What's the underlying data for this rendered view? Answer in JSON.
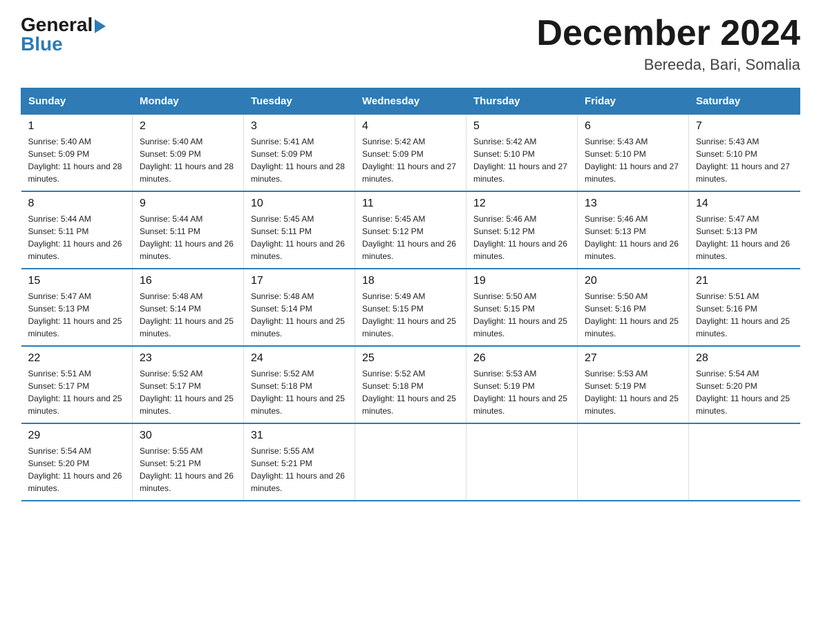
{
  "logo": {
    "general": "General",
    "blue": "Blue"
  },
  "header": {
    "month": "December 2024",
    "location": "Bereeda, Bari, Somalia"
  },
  "weekdays": [
    "Sunday",
    "Monday",
    "Tuesday",
    "Wednesday",
    "Thursday",
    "Friday",
    "Saturday"
  ],
  "weeks": [
    [
      {
        "day": "1",
        "sunrise": "5:40 AM",
        "sunset": "5:09 PM",
        "daylight": "11 hours and 28 minutes."
      },
      {
        "day": "2",
        "sunrise": "5:40 AM",
        "sunset": "5:09 PM",
        "daylight": "11 hours and 28 minutes."
      },
      {
        "day": "3",
        "sunrise": "5:41 AM",
        "sunset": "5:09 PM",
        "daylight": "11 hours and 28 minutes."
      },
      {
        "day": "4",
        "sunrise": "5:42 AM",
        "sunset": "5:09 PM",
        "daylight": "11 hours and 27 minutes."
      },
      {
        "day": "5",
        "sunrise": "5:42 AM",
        "sunset": "5:10 PM",
        "daylight": "11 hours and 27 minutes."
      },
      {
        "day": "6",
        "sunrise": "5:43 AM",
        "sunset": "5:10 PM",
        "daylight": "11 hours and 27 minutes."
      },
      {
        "day": "7",
        "sunrise": "5:43 AM",
        "sunset": "5:10 PM",
        "daylight": "11 hours and 27 minutes."
      }
    ],
    [
      {
        "day": "8",
        "sunrise": "5:44 AM",
        "sunset": "5:11 PM",
        "daylight": "11 hours and 26 minutes."
      },
      {
        "day": "9",
        "sunrise": "5:44 AM",
        "sunset": "5:11 PM",
        "daylight": "11 hours and 26 minutes."
      },
      {
        "day": "10",
        "sunrise": "5:45 AM",
        "sunset": "5:11 PM",
        "daylight": "11 hours and 26 minutes."
      },
      {
        "day": "11",
        "sunrise": "5:45 AM",
        "sunset": "5:12 PM",
        "daylight": "11 hours and 26 minutes."
      },
      {
        "day": "12",
        "sunrise": "5:46 AM",
        "sunset": "5:12 PM",
        "daylight": "11 hours and 26 minutes."
      },
      {
        "day": "13",
        "sunrise": "5:46 AM",
        "sunset": "5:13 PM",
        "daylight": "11 hours and 26 minutes."
      },
      {
        "day": "14",
        "sunrise": "5:47 AM",
        "sunset": "5:13 PM",
        "daylight": "11 hours and 26 minutes."
      }
    ],
    [
      {
        "day": "15",
        "sunrise": "5:47 AM",
        "sunset": "5:13 PM",
        "daylight": "11 hours and 25 minutes."
      },
      {
        "day": "16",
        "sunrise": "5:48 AM",
        "sunset": "5:14 PM",
        "daylight": "11 hours and 25 minutes."
      },
      {
        "day": "17",
        "sunrise": "5:48 AM",
        "sunset": "5:14 PM",
        "daylight": "11 hours and 25 minutes."
      },
      {
        "day": "18",
        "sunrise": "5:49 AM",
        "sunset": "5:15 PM",
        "daylight": "11 hours and 25 minutes."
      },
      {
        "day": "19",
        "sunrise": "5:50 AM",
        "sunset": "5:15 PM",
        "daylight": "11 hours and 25 minutes."
      },
      {
        "day": "20",
        "sunrise": "5:50 AM",
        "sunset": "5:16 PM",
        "daylight": "11 hours and 25 minutes."
      },
      {
        "day": "21",
        "sunrise": "5:51 AM",
        "sunset": "5:16 PM",
        "daylight": "11 hours and 25 minutes."
      }
    ],
    [
      {
        "day": "22",
        "sunrise": "5:51 AM",
        "sunset": "5:17 PM",
        "daylight": "11 hours and 25 minutes."
      },
      {
        "day": "23",
        "sunrise": "5:52 AM",
        "sunset": "5:17 PM",
        "daylight": "11 hours and 25 minutes."
      },
      {
        "day": "24",
        "sunrise": "5:52 AM",
        "sunset": "5:18 PM",
        "daylight": "11 hours and 25 minutes."
      },
      {
        "day": "25",
        "sunrise": "5:52 AM",
        "sunset": "5:18 PM",
        "daylight": "11 hours and 25 minutes."
      },
      {
        "day": "26",
        "sunrise": "5:53 AM",
        "sunset": "5:19 PM",
        "daylight": "11 hours and 25 minutes."
      },
      {
        "day": "27",
        "sunrise": "5:53 AM",
        "sunset": "5:19 PM",
        "daylight": "11 hours and 25 minutes."
      },
      {
        "day": "28",
        "sunrise": "5:54 AM",
        "sunset": "5:20 PM",
        "daylight": "11 hours and 25 minutes."
      }
    ],
    [
      {
        "day": "29",
        "sunrise": "5:54 AM",
        "sunset": "5:20 PM",
        "daylight": "11 hours and 26 minutes."
      },
      {
        "day": "30",
        "sunrise": "5:55 AM",
        "sunset": "5:21 PM",
        "daylight": "11 hours and 26 minutes."
      },
      {
        "day": "31",
        "sunrise": "5:55 AM",
        "sunset": "5:21 PM",
        "daylight": "11 hours and 26 minutes."
      },
      null,
      null,
      null,
      null
    ]
  ]
}
